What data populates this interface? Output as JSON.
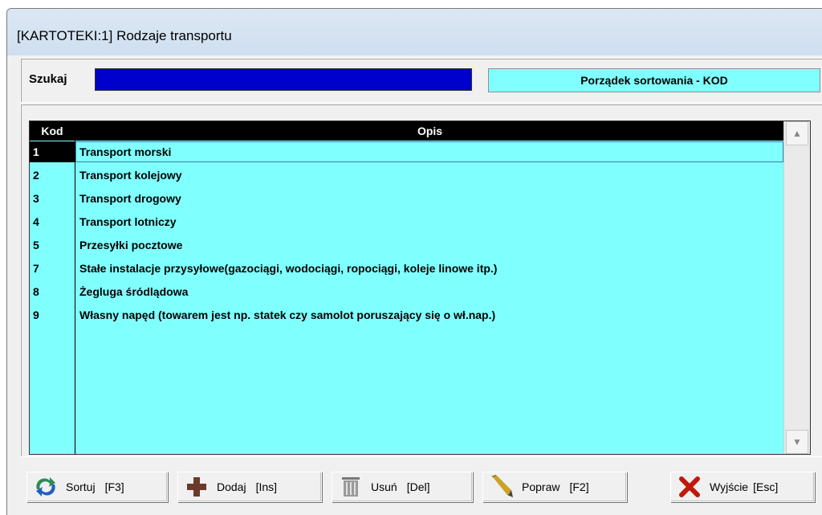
{
  "window": {
    "title": "[KARTOTEKI:1]  Rodzaje transportu"
  },
  "search": {
    "label": "Szukaj",
    "value": ""
  },
  "sort": {
    "label": "Porządek sortowania - KOD"
  },
  "table": {
    "headers": {
      "kod": "Kod",
      "opis": "Opis"
    },
    "selected_index": 0,
    "rows": [
      {
        "kod": "1",
        "opis": "Transport morski"
      },
      {
        "kod": "2",
        "opis": "Transport kolejowy"
      },
      {
        "kod": "3",
        "opis": "Transport drogowy"
      },
      {
        "kod": "4",
        "opis": "Transport lotniczy"
      },
      {
        "kod": "5",
        "opis": "Przesyłki pocztowe"
      },
      {
        "kod": "7",
        "opis": " Stałe instalacje przysyłowe(gazociągi, wodociągi, ropociągi, koleje linowe itp.)"
      },
      {
        "kod": "8",
        "opis": "Żegluga śródlądowa"
      },
      {
        "kod": "9",
        "opis": "Własny napęd (towarem jest np. statek czy samolot poruszający się o wł.nap.)"
      }
    ]
  },
  "toolbar": {
    "sortuj": {
      "label": "Sortuj",
      "key": "[F3]",
      "icon": "sort-arrows-icon"
    },
    "dodaj": {
      "label": "Dodaj",
      "key": "[Ins]",
      "icon": "plus-icon"
    },
    "usun": {
      "label": "Usuń",
      "key": "[Del]",
      "icon": "trash-icon"
    },
    "popraw": {
      "label": "Popraw",
      "key": "[F2]",
      "icon": "pencil-icon"
    },
    "wyjscie": {
      "label": "Wyjście",
      "key": "[Esc]",
      "icon": "close-x-icon"
    }
  },
  "colors": {
    "grid_bg": "#80ffff",
    "search_bg": "#0000cc",
    "header_bg": "#000000"
  }
}
